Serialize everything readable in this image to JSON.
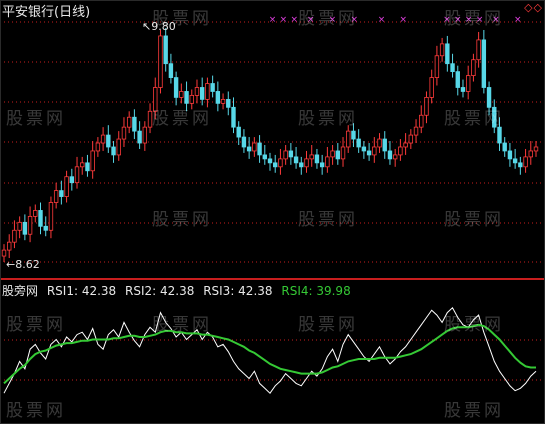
{
  "chart": {
    "title": "平安银行(日线)",
    "max_label": "9.80",
    "min_label": "8.62",
    "corner_markers": "◇◇",
    "watermark": "股票网",
    "indicator": {
      "name": "股旁网",
      "rsi1": "RSI1: 42.38",
      "rsi2": "RSI2: 42.38",
      "rsi3": "RSI3: 42.38",
      "rsi4": "RSI4: 39.98"
    },
    "colors": {
      "up": "#ff3b3b",
      "down": "#58d8e8",
      "grid": "#c81e1e",
      "white_line": "#ffffff",
      "green_line": "#35c935",
      "marker": "#e040e0"
    }
  },
  "chart_data": {
    "type": "candlestick",
    "price_min": 8.62,
    "price_max": 9.8,
    "closes": [
      8.68,
      8.72,
      8.78,
      8.82,
      8.76,
      8.85,
      8.88,
      8.8,
      8.78,
      8.92,
      8.98,
      8.95,
      9.05,
      9.02,
      9.1,
      9.12,
      9.08,
      9.18,
      9.22,
      9.26,
      9.2,
      9.16,
      9.24,
      9.3,
      9.35,
      9.28,
      9.22,
      9.3,
      9.38,
      9.5,
      9.76,
      9.62,
      9.55,
      9.45,
      9.48,
      9.42,
      9.46,
      9.5,
      9.44,
      9.52,
      9.48,
      9.42,
      9.44,
      9.4,
      9.3,
      9.25,
      9.2,
      9.18,
      9.22,
      9.16,
      9.14,
      9.12,
      9.1,
      9.14,
      9.18,
      9.15,
      9.12,
      9.1,
      9.14,
      9.16,
      9.12,
      9.1,
      9.15,
      9.18,
      9.14,
      9.2,
      9.28,
      9.24,
      9.2,
      9.18,
      9.16,
      9.2,
      9.24,
      9.18,
      9.14,
      9.16,
      9.2,
      9.22,
      9.26,
      9.3,
      9.36,
      9.45,
      9.55,
      9.66,
      9.72,
      9.62,
      9.58,
      9.5,
      9.48,
      9.56,
      9.64,
      9.74,
      9.5,
      9.4,
      9.3,
      9.22,
      9.18,
      9.14,
      9.12,
      9.1,
      9.15,
      9.18,
      9.2
    ],
    "rsi_white": [
      22,
      30,
      38,
      48,
      42,
      58,
      62,
      55,
      50,
      62,
      66,
      60,
      68,
      64,
      70,
      72,
      66,
      75,
      62,
      58,
      70,
      74,
      68,
      80,
      72,
      65,
      60,
      70,
      76,
      72,
      88,
      80,
      75,
      68,
      72,
      66,
      70,
      74,
      66,
      72,
      68,
      60,
      62,
      56,
      48,
      42,
      38,
      34,
      40,
      30,
      26,
      22,
      28,
      32,
      38,
      34,
      30,
      28,
      34,
      40,
      36,
      42,
      52,
      58,
      48,
      62,
      70,
      64,
      58,
      52,
      48,
      54,
      60,
      52,
      46,
      50,
      56,
      60,
      66,
      72,
      78,
      84,
      90,
      86,
      80,
      88,
      92,
      84,
      78,
      76,
      82,
      86,
      72,
      60,
      48,
      40,
      34,
      28,
      24,
      26,
      30,
      36,
      40
    ],
    "rsi_green": [
      30,
      34,
      38,
      42,
      45,
      50,
      54,
      56,
      57,
      59,
      61,
      62,
      63,
      63,
      64,
      65,
      65,
      66,
      66,
      66,
      66,
      67,
      67,
      68,
      69,
      69,
      68,
      68,
      69,
      70,
      72,
      73,
      73,
      72,
      72,
      71,
      71,
      71,
      70,
      70,
      69,
      68,
      67,
      66,
      64,
      62,
      60,
      57,
      55,
      52,
      49,
      46,
      44,
      42,
      41,
      40,
      39,
      38,
      38,
      38,
      38,
      39,
      41,
      43,
      44,
      46,
      48,
      49,
      50,
      50,
      50,
      50,
      51,
      51,
      51,
      51,
      52,
      53,
      54,
      56,
      58,
      61,
      64,
      67,
      70,
      73,
      75,
      76,
      76,
      76,
      77,
      78,
      77,
      74,
      70,
      66,
      61,
      56,
      51,
      47,
      44,
      43,
      43
    ],
    "markers_x_fraction": [
      0.5,
      0.52,
      0.54,
      0.57,
      0.61,
      0.65,
      0.7,
      0.74,
      0.82,
      0.84,
      0.86,
      0.88,
      0.91,
      0.95
    ]
  }
}
